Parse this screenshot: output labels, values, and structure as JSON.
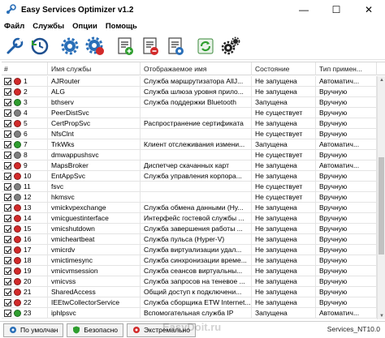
{
  "window": {
    "title": "Easy Services Optimizer v1.2",
    "minimize": "—",
    "maximize": "☐",
    "close": "✕"
  },
  "menu": [
    "Файл",
    "Службы",
    "Опции",
    "Помощь"
  ],
  "toolbar": {
    "icons": [
      "wrench-icon",
      "history-clock-icon",
      "gear-settings-icon",
      "gear-red-icon",
      "list-green-icon",
      "list-red-icon",
      "list-blue-icon",
      "refresh-icon",
      "gears-black-icon"
    ]
  },
  "colors": {
    "green": "#2f9e2f",
    "red": "#d22a2a",
    "gray": "#7f7f7f"
  },
  "columns": [
    "#",
    "Имя службы",
    "Отображаемое имя",
    "Состояние",
    "Тип примен..."
  ],
  "rows": [
    {
      "n": "1",
      "status": "red",
      "name": "AJRouter",
      "display": "Служба маршрутизатора AllJ...",
      "state": "Не запущена",
      "type": "Автоматич..."
    },
    {
      "n": "2",
      "status": "red",
      "name": "ALG",
      "display": "Служба шлюза уровня прило...",
      "state": "Не запущена",
      "type": "Вручную"
    },
    {
      "n": "3",
      "status": "green",
      "name": "bthserv",
      "display": "Служба поддержки Bluetooth",
      "state": "Запущена",
      "type": "Вручную"
    },
    {
      "n": "4",
      "status": "gray",
      "name": "PeerDistSvc",
      "display": "",
      "state": "Не существует",
      "type": "Вручную"
    },
    {
      "n": "5",
      "status": "red",
      "name": "CertPropSvc",
      "display": "Распространение сертификата",
      "state": "Не запущена",
      "type": "Вручную"
    },
    {
      "n": "6",
      "status": "gray",
      "name": "NfsClnt",
      "display": "",
      "state": "Не существует",
      "type": "Вручную"
    },
    {
      "n": "7",
      "status": "green",
      "name": "TrkWks",
      "display": "Клиент отслеживания измени...",
      "state": "Запущена",
      "type": "Автоматич..."
    },
    {
      "n": "8",
      "status": "gray",
      "name": "dmwappushsvc",
      "display": "",
      "state": "Не существует",
      "type": "Вручную"
    },
    {
      "n": "9",
      "status": "red",
      "name": "MapsBroker",
      "display": "Диспетчер скачанных карт",
      "state": "Не запущена",
      "type": "Автоматич..."
    },
    {
      "n": "10",
      "status": "red",
      "name": "EntAppSvc",
      "display": "Служба управления корпора...",
      "state": "Не запущена",
      "type": "Вручную"
    },
    {
      "n": "11",
      "status": "gray",
      "name": "fsvc",
      "display": "",
      "state": "Не существует",
      "type": "Вручную"
    },
    {
      "n": "12",
      "status": "gray",
      "name": "hkmsvc",
      "display": "",
      "state": "Не существует",
      "type": "Вручную"
    },
    {
      "n": "13",
      "status": "red",
      "name": "vmickvpexchange",
      "display": "Служба обмена данными (Hy...",
      "state": "Не запущена",
      "type": "Вручную"
    },
    {
      "n": "14",
      "status": "red",
      "name": "vmicguestinterface",
      "display": "Интерфейс гостевой службы ...",
      "state": "Не запущена",
      "type": "Вручную"
    },
    {
      "n": "15",
      "status": "red",
      "name": "vmicshutdown",
      "display": "Служба завершения работы ...",
      "state": "Не запущена",
      "type": "Вручную"
    },
    {
      "n": "16",
      "status": "red",
      "name": "vmicheartbeat",
      "display": "Служба пульса (Hyper-V)",
      "state": "Не запущена",
      "type": "Вручную"
    },
    {
      "n": "17",
      "status": "red",
      "name": "vmicrdv",
      "display": "Служба виртуализации удал...",
      "state": "Не запущена",
      "type": "Вручную"
    },
    {
      "n": "18",
      "status": "red",
      "name": "vmictimesync",
      "display": "Служба синхронизации време...",
      "state": "Не запущена",
      "type": "Вручную"
    },
    {
      "n": "19",
      "status": "red",
      "name": "vmicvmsession",
      "display": "Служба сеансов виртуальны...",
      "state": "Не запущена",
      "type": "Вручную"
    },
    {
      "n": "20",
      "status": "red",
      "name": "vmicvss",
      "display": "Служба запросов на теневое ...",
      "state": "Не запущена",
      "type": "Вручную"
    },
    {
      "n": "21",
      "status": "red",
      "name": "SharedAccess",
      "display": "Общий доступ к подключени...",
      "state": "Не запущена",
      "type": "Вручную"
    },
    {
      "n": "22",
      "status": "red",
      "name": "IEEtwCollectorService",
      "display": "Служба сборщика ETW Internet...",
      "state": "Не запущена",
      "type": "Вручную"
    },
    {
      "n": "23",
      "status": "green",
      "name": "iphlpsvc",
      "display": "Вспомогательная служба IP",
      "state": "Запущена",
      "type": "Автоматич..."
    }
  ],
  "bottom_tabs": [
    "По умолчан",
    "Безопасно",
    "Экстремально"
  ],
  "watermark": "EasyDoit.ru",
  "status_right": "Services_NT10.0"
}
